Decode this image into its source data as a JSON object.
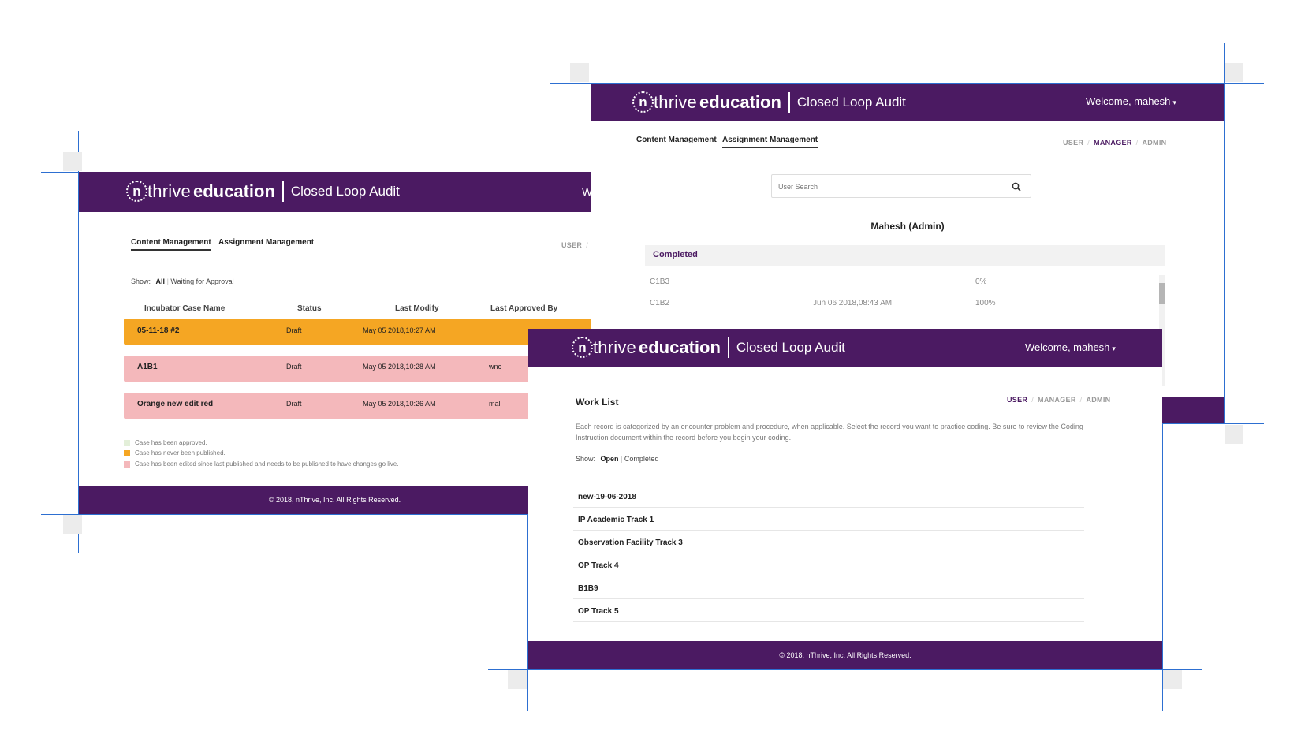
{
  "brand": {
    "name_prefix": "n",
    "name_thrive": "thrive",
    "name_education": "education",
    "product": "Closed Loop Audit"
  },
  "user": {
    "welcome": "Welcome, mahesh"
  },
  "roles": {
    "user": "USER",
    "manager": "MANAGER",
    "admin": "ADMIN"
  },
  "nav": {
    "content": "Content Management",
    "assignment": "Assignment Management"
  },
  "footer": {
    "copyright": "© 2018, nThrive, Inc. All Rights Reserved."
  },
  "content_panel": {
    "show_label": "Show:",
    "filters": [
      "All",
      "Waiting for Approval"
    ],
    "columns": [
      "Incubator Case Name",
      "Status",
      "Last Modify",
      "Last Approved By"
    ],
    "rows": [
      {
        "name": "05-11-18 #2",
        "status": "Draft",
        "modified": "May 05 2018,10:27 AM",
        "approved_by": "",
        "color": "#f5a623"
      },
      {
        "name": "A1B1",
        "status": "Draft",
        "modified": "May 05 2018,10:28 AM",
        "approved_by": "wnc",
        "color": "#f4b8bb"
      },
      {
        "name": "Orange new edit red",
        "status": "Draft",
        "modified": "May 05 2018,10:26 AM",
        "approved_by": "mal",
        "color": "#f4b8bb"
      }
    ],
    "legend": [
      {
        "text": "Case has been approved.",
        "color": "#e3efd9"
      },
      {
        "text": "Case has never been published.",
        "color": "#f5a623"
      },
      {
        "text": "Case has been edited since last published and needs to be published to have changes go live.",
        "color": "#f4b8bb"
      }
    ]
  },
  "assignment_panel": {
    "search_placeholder": "User Search",
    "user_heading": "Mahesh (Admin)",
    "section": "Completed",
    "rows": [
      {
        "name": "C1B3",
        "date": "",
        "progress": "0%"
      },
      {
        "name": "C1B2",
        "date": "Jun 06 2018,08:43 AM",
        "progress": "100%"
      }
    ]
  },
  "worklist_panel": {
    "title": "Work List",
    "description": "Each record is categorized by an encounter problem and procedure, when applicable. Select the record you want to practice coding. Be sure to review the Coding Instruction document within the record before you begin your coding.",
    "show_label": "Show:",
    "filters": [
      "Open",
      "Completed"
    ],
    "items": [
      "new-19-06-2018",
      "IP Academic Track 1",
      "Observation Facility Track 3",
      "OP Track 4",
      "B1B9",
      "OP Track 5"
    ]
  },
  "colors": {
    "brand_purple": "#4b1a62",
    "orange": "#f5a623",
    "pink": "#f4b8bb"
  }
}
